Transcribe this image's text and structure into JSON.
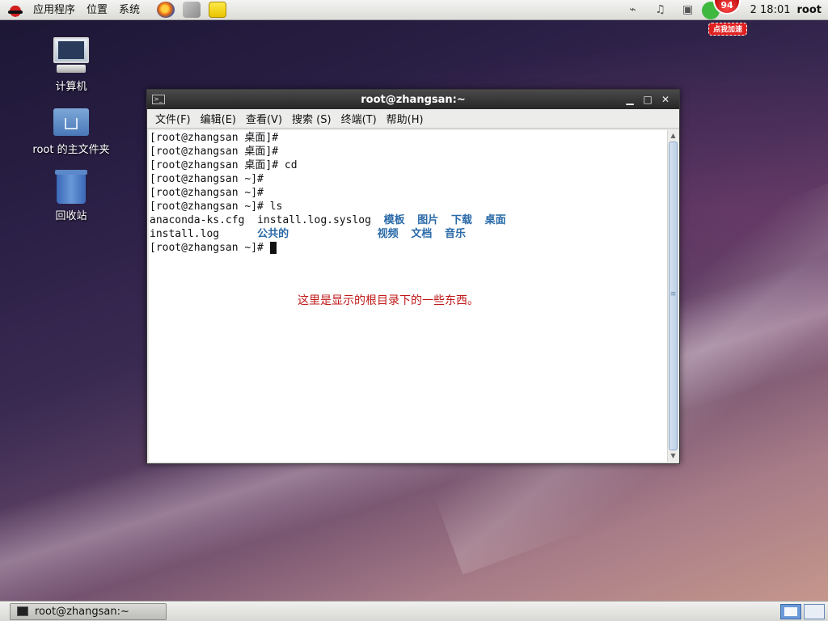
{
  "top_panel": {
    "menus": [
      "应用程序",
      "位置",
      "系统"
    ],
    "clock": "2 18:01",
    "user": "root",
    "speed_badge": {
      "number": "94",
      "label": "点我加速"
    }
  },
  "desktop": {
    "icons": [
      {
        "label": "计算机",
        "icon": "computer-icon"
      },
      {
        "label": "root 的主文件夹",
        "icon": "home-folder-icon"
      },
      {
        "label": "回收站",
        "icon": "trash-icon"
      }
    ]
  },
  "terminal": {
    "title": "root@zhangsan:~",
    "menus": [
      "文件(F)",
      "编辑(E)",
      "查看(V)",
      "搜索 (S)",
      "终端(T)",
      "帮助(H)"
    ],
    "lines": [
      "[root@zhangsan 桌面]#",
      "[root@zhangsan 桌面]#",
      "[root@zhangsan 桌面]# cd",
      "[root@zhangsan ~]#",
      "[root@zhangsan ~]#",
      "[root@zhangsan ~]# ls"
    ],
    "ls_row1": {
      "f1": "anaconda-ks.cfg",
      "f2": "install.log.syslog",
      "d1": "模板",
      "d2": "图片",
      "d3": "下载",
      "d4": "桌面"
    },
    "ls_row2": {
      "f1": "install.log",
      "d0": "公共的",
      "d1": "视频",
      "d2": "文档",
      "d3": "音乐"
    },
    "prompt": "[root@zhangsan ~]# ",
    "annotation": "这里是显示的根目录下的一些东西。",
    "dir_color": "#2a6aa8",
    "annotation_color": "#c01818"
  },
  "bottom_panel": {
    "task_label": "root@zhangsan:~"
  }
}
